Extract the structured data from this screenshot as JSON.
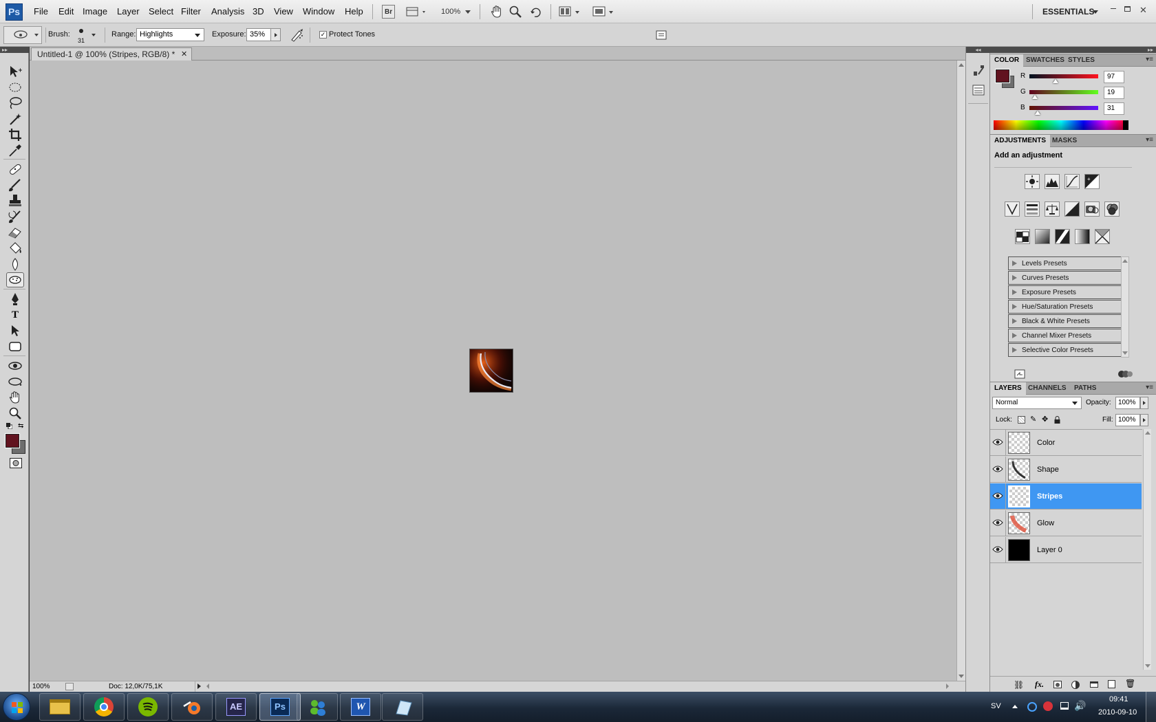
{
  "app": {
    "logo": "Ps"
  },
  "menubar": {
    "items": [
      "File",
      "Edit",
      "Image",
      "Layer",
      "Select",
      "Filter",
      "Analysis",
      "3D",
      "View",
      "Window",
      "Help"
    ],
    "bridge": "Br",
    "zoom": "100%",
    "workspace": "ESSENTIALS"
  },
  "options": {
    "brush_label": "Brush:",
    "brush_size": "31",
    "range_label": "Range:",
    "range_value": "Highlights",
    "exposure_label": "Exposure:",
    "exposure_value": "35%",
    "protect_tones": "Protect Tones",
    "protect_tones_checked": true
  },
  "document": {
    "tab_title": "Untitled-1 @ 100% (Stripes, RGB/8) *",
    "status_zoom": "100%",
    "status_doc": "Doc: 12,0K/75,1K"
  },
  "color_panel": {
    "tabs": [
      "COLOR",
      "SWATCHES",
      "STYLES"
    ],
    "r_label": "R",
    "g_label": "G",
    "b_label": "B",
    "r": "97",
    "g": "19",
    "b": "31",
    "r_level": 0.38,
    "g_level": 0.075,
    "b_level": 0.12,
    "foreground": "#61131f",
    "background": "#6e6e6e"
  },
  "adjustments_panel": {
    "tabs": [
      "ADJUSTMENTS",
      "MASKS"
    ],
    "heading": "Add an adjustment",
    "presets": [
      "Levels Presets",
      "Curves Presets",
      "Exposure Presets",
      "Hue/Saturation Presets",
      "Black & White Presets",
      "Channel Mixer Presets",
      "Selective Color Presets"
    ]
  },
  "layers_panel": {
    "tabs": [
      "LAYERS",
      "CHANNELS",
      "PATHS"
    ],
    "blend_mode": "Normal",
    "opacity_label": "Opacity:",
    "opacity": "100%",
    "lock_label": "Lock:",
    "fill_label": "Fill:",
    "fill": "100%",
    "layers": [
      {
        "name": "Color",
        "selected": false
      },
      {
        "name": "Shape",
        "selected": false
      },
      {
        "name": "Stripes",
        "selected": true
      },
      {
        "name": "Glow",
        "selected": false
      },
      {
        "name": "Layer 0",
        "selected": false
      }
    ]
  },
  "taskbar": {
    "ae_label": "AE",
    "ps_label": "Ps",
    "language": "SV",
    "time": "09:41",
    "date": "2010-09-10"
  }
}
